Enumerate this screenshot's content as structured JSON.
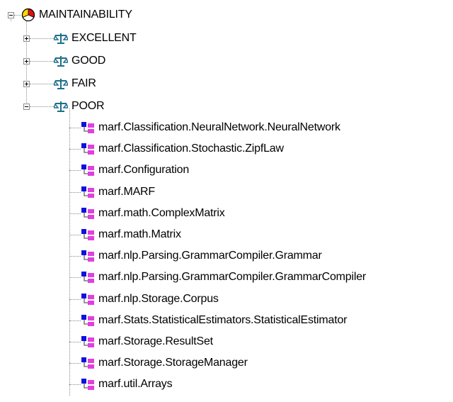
{
  "tree": {
    "root": {
      "label": "MAINTAINABILITY",
      "icon": "pie-chart-icon",
      "expanded": true
    },
    "categories": [
      {
        "label": "EXCELLENT",
        "icon": "scales-icon",
        "expanded": false
      },
      {
        "label": "GOOD",
        "icon": "scales-icon",
        "expanded": false
      },
      {
        "label": "FAIR",
        "icon": "scales-icon",
        "expanded": false
      },
      {
        "label": "POOR",
        "icon": "scales-icon",
        "expanded": true
      }
    ],
    "poor_items": [
      "marf.Classification.NeuralNetwork.NeuralNetwork",
      "marf.Classification.Stochastic.ZipfLaw",
      "marf.Configuration",
      "marf.MARF",
      "marf.math.ComplexMatrix",
      "marf.math.Matrix",
      "marf.nlp.Parsing.GrammarCompiler.Grammar",
      "marf.nlp.Parsing.GrammarCompiler.GrammarCompiler",
      "marf.nlp.Storage.Corpus",
      "marf.Stats.StatisticalEstimators.StatisticalEstimator",
      "marf.Storage.ResultSet",
      "marf.Storage.StorageManager",
      "marf.util.Arrays"
    ],
    "class_icon": "class-icon",
    "colors": {
      "class_icon_blue": "#1010e0",
      "class_icon_magenta": "#e040e0",
      "scales_teal": "#1f6f8b",
      "pie_red": "#e01010",
      "pie_yellow": "#ffd800",
      "connector": "#8a8a8a"
    }
  }
}
